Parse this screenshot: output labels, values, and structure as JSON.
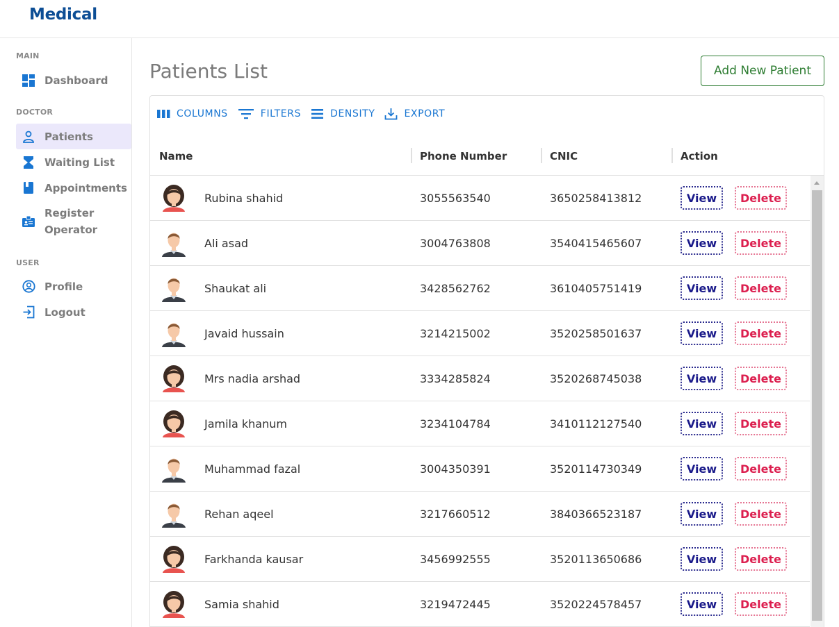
{
  "app": {
    "title": "Medical"
  },
  "sidebar": {
    "sections": [
      {
        "title": "MAIN",
        "items": [
          {
            "label": "Dashboard",
            "icon": "dashboard-icon"
          }
        ]
      },
      {
        "title": "DOCTOR",
        "items": [
          {
            "label": "Patients",
            "icon": "person-icon",
            "active": true
          },
          {
            "label": "Waiting List",
            "icon": "hourglass-icon"
          },
          {
            "label": "Appointments",
            "icon": "book-icon"
          },
          {
            "label": "Register\nOperator",
            "icon": "badge-icon"
          }
        ]
      },
      {
        "title": "USER",
        "items": [
          {
            "label": "Profile",
            "icon": "account-circle-icon"
          },
          {
            "label": "Logout",
            "icon": "logout-icon"
          }
        ]
      }
    ]
  },
  "page": {
    "title": "Patients List",
    "add_button": "Add New Patient"
  },
  "toolbar": {
    "columns": "COLUMNS",
    "filters": "FILTERS",
    "density": "DENSITY",
    "export": "EXPORT"
  },
  "table": {
    "columns": [
      "Name",
      "Phone Number",
      "CNIC",
      "Action"
    ],
    "view_label": "View",
    "delete_label": "Delete",
    "rows": [
      {
        "name": "Rubina shahid",
        "phone": "3055563540",
        "cnic": "3650258413812",
        "avatar": "female-avatar-icon"
      },
      {
        "name": "Ali asad",
        "phone": "3004763808",
        "cnic": "3540415465607",
        "avatar": "male-avatar-icon"
      },
      {
        "name": "Shaukat ali",
        "phone": "3428562762",
        "cnic": "3610405751419",
        "avatar": "male-avatar-icon"
      },
      {
        "name": "Javaid hussain",
        "phone": "3214215002",
        "cnic": "3520258501637",
        "avatar": "male-avatar-icon"
      },
      {
        "name": "Mrs nadia arshad",
        "phone": "3334285824",
        "cnic": "3520268745038",
        "avatar": "female-avatar-icon"
      },
      {
        "name": "Jamila khanum",
        "phone": "3234104784",
        "cnic": "3410112127540",
        "avatar": "female-avatar-icon"
      },
      {
        "name": "Muhammad fazal",
        "phone": "3004350391",
        "cnic": "3520114730349",
        "avatar": "male-avatar-icon"
      },
      {
        "name": "Rehan aqeel",
        "phone": "3217660512",
        "cnic": "3840366523187",
        "avatar": "male-avatar-icon"
      },
      {
        "name": "Farkhanda kausar",
        "phone": "3456992555",
        "cnic": "3520113650686",
        "avatar": "female-avatar-icon"
      },
      {
        "name": "Samia shahid",
        "phone": "3219472445",
        "cnic": "3520224578457",
        "avatar": "female-avatar-icon"
      }
    ]
  },
  "colors": {
    "brand": "#0d4e95",
    "accent": "#1976d2",
    "success": "#2e7d32",
    "danger": "#dc1e4e",
    "view": "#1a1a8a",
    "active_nav": "#ebe8fb"
  }
}
